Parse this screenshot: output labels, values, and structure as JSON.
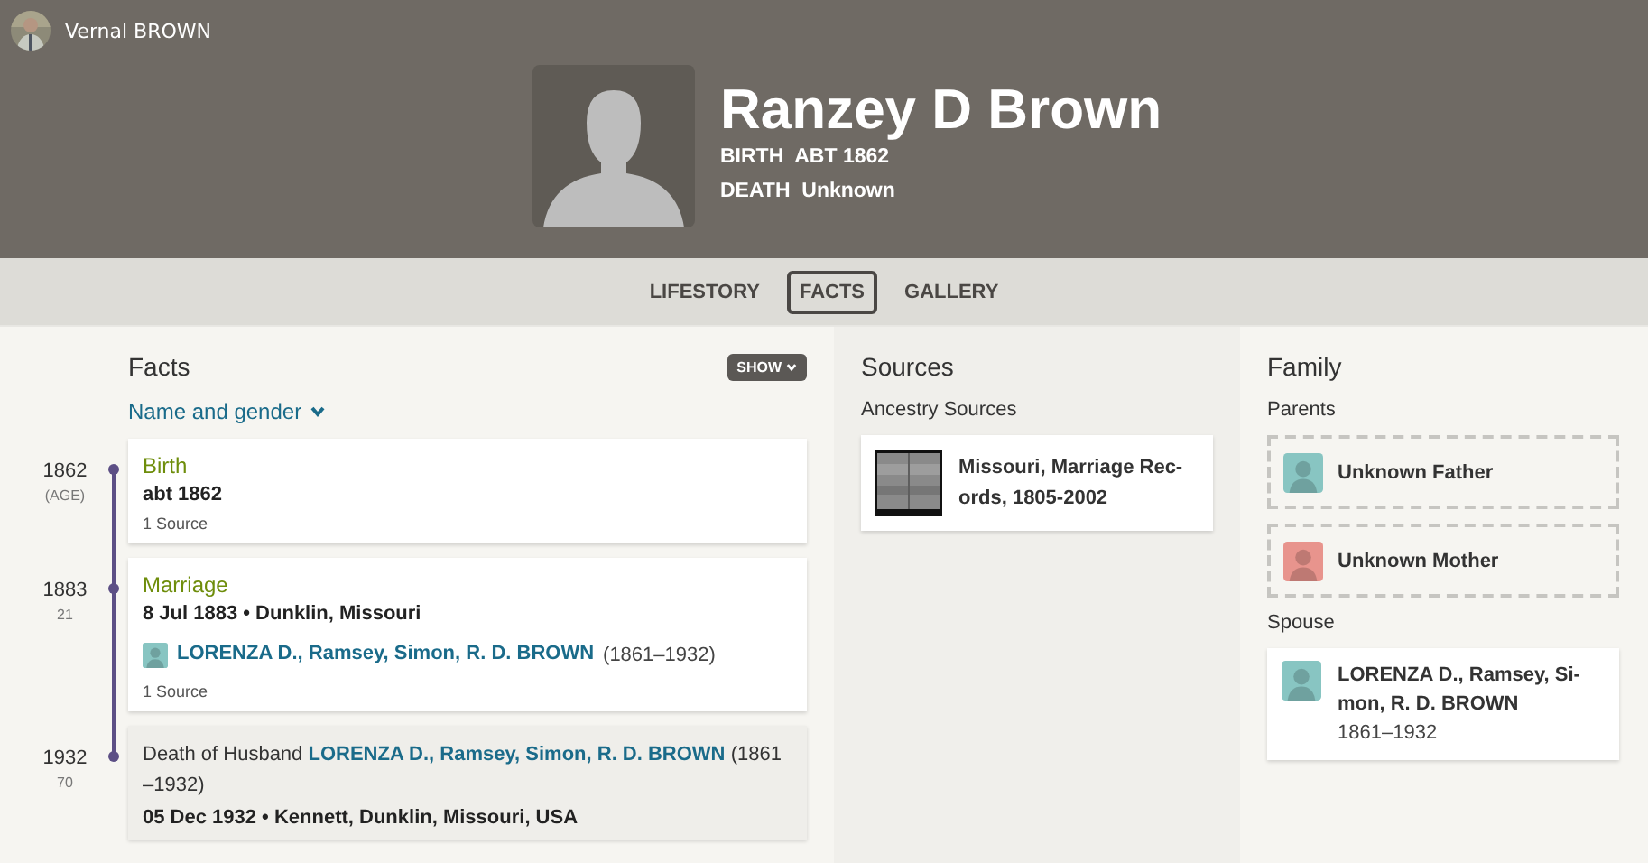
{
  "user": {
    "name": "Vernal BROWN"
  },
  "person": {
    "name": "Ranzey D Brown",
    "facts": [
      {
        "label": "BIRTH",
        "value": "ABT 1862"
      },
      {
        "label": "DEATH",
        "value": "Unknown"
      }
    ]
  },
  "tabs": [
    {
      "label": "LIFESTORY",
      "selected": false
    },
    {
      "label": "FACTS",
      "selected": true
    },
    {
      "label": "GALLERY",
      "selected": false
    }
  ],
  "facts": {
    "title": "Facts",
    "show_button": "SHOW",
    "filter": "Name and gender",
    "events": [
      {
        "kind": "fact",
        "year": "1862",
        "age": "(AGE)",
        "title": "Birth",
        "detail": "abt 1862",
        "sources": "1 Source"
      },
      {
        "kind": "fact",
        "year": "1883",
        "age": "21",
        "title": "Marriage",
        "detail": "8 Jul 1883 • Dunklin, Missouri",
        "person": {
          "name": "LORENZA D., Ramsey, Simon, R. D. BROWN",
          "dates": "(1861–1932)"
        },
        "sources": "1 Source"
      },
      {
        "kind": "family",
        "year": "1932",
        "age": "70",
        "title": "Death of Husband",
        "person": {
          "name": "LORENZA D., Ramsey, Simon, R. D. BROWN",
          "dates": "(1861 –1932)"
        },
        "detail": "05 Dec 1932 • Kennett, Dunklin, Missouri, USA"
      }
    ]
  },
  "sources": {
    "title": "Sources",
    "group": "Ancestry Sources",
    "items": [
      {
        "title": "Missouri, Marriage Rec-ords, 1805-2002",
        "kind": "picture"
      }
    ]
  },
  "family": {
    "title": "Family",
    "parents_label": "Parents",
    "parents": [
      {
        "name": "Unknown Father",
        "color": "#88c5c2"
      },
      {
        "name": "Unknown Mother",
        "color": "#e8948d"
      }
    ],
    "spouse_label": "Spouse",
    "spouses": [
      {
        "name": "LORENZA D., Ramsey, Si-mon, R. D. BROWN",
        "dates": "1861–1932",
        "color": "#88c5c2"
      }
    ]
  }
}
